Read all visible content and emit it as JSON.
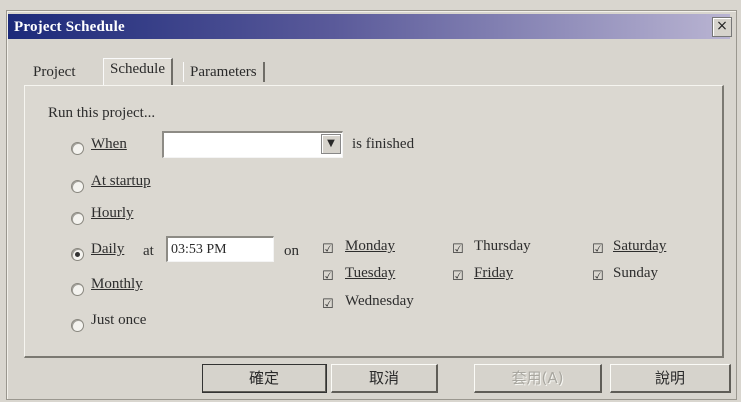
{
  "window": {
    "title": "Project Schedule",
    "close_symbol": "×"
  },
  "tabs": [
    {
      "label": "Project"
    },
    {
      "label": "Schedule",
      "active": true
    },
    {
      "label": "Parameters"
    }
  ],
  "schedule": {
    "run_label": "Run this project...",
    "when": {
      "label": "When",
      "value": "",
      "suffix": "is finished"
    },
    "options": {
      "at_startup": "At startup",
      "hourly": "Hourly",
      "daily": "Daily",
      "monthly": "Monthly",
      "just_once": "Just once"
    },
    "selected": "daily",
    "at_label": "at",
    "time": "03:53 PM",
    "on_label": "on",
    "days": {
      "monday": "Monday",
      "tuesday": "Tuesday",
      "wednesday": "Wednesday",
      "thursday": "Thursday",
      "friday": "Friday",
      "saturday": "Saturday",
      "sunday": "Sunday"
    },
    "check_mark": "☑"
  },
  "buttons": {
    "ok": "確定",
    "cancel": "取消",
    "apply": "套用(A)",
    "help": "說明"
  },
  "icons": {
    "dropdown": "▼"
  }
}
